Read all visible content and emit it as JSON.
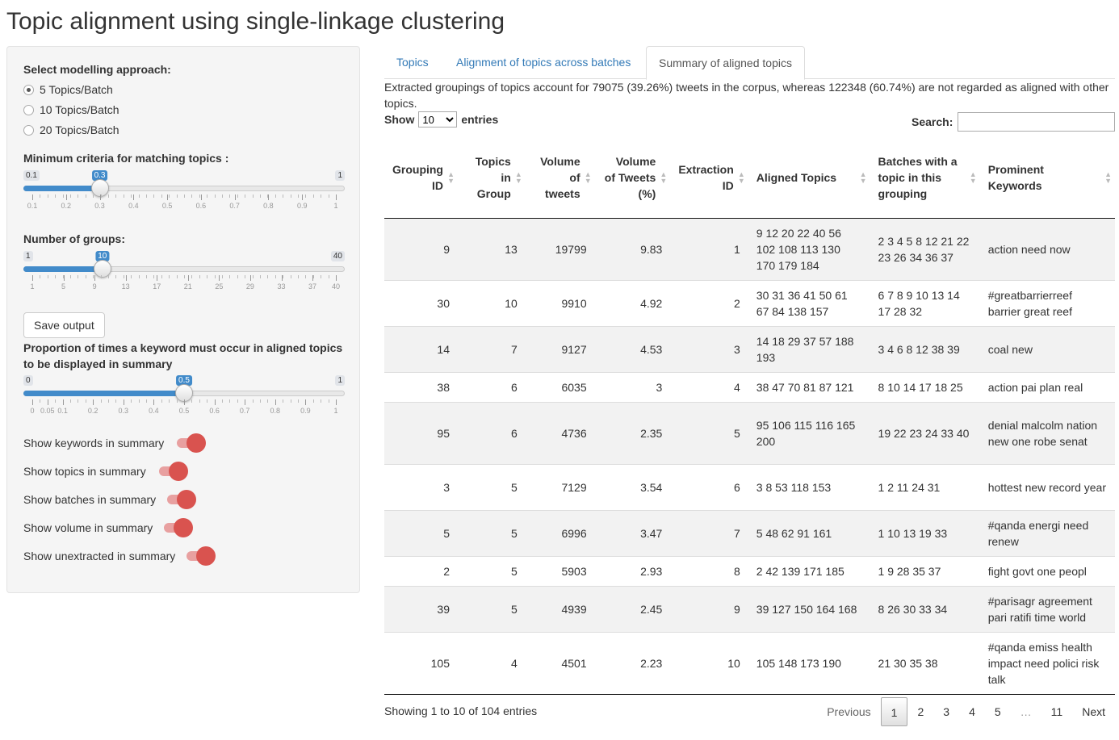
{
  "title": "Topic alignment using single-linkage clustering",
  "sidebar": {
    "modelling_label": "Select modelling approach:",
    "options": [
      "5 Topics/Batch",
      "10 Topics/Batch",
      "20 Topics/Batch"
    ],
    "selected_option": "5 Topics/Batch",
    "criteria_label": "Minimum criteria for matching topics :",
    "criteria_slider": {
      "min": "0.1",
      "max": "1",
      "value": "0.3",
      "ticks": [
        "0.1",
        "0.2",
        "0.3",
        "0.4",
        "0.5",
        "0.6",
        "0.7",
        "0.8",
        "0.9",
        "1"
      ]
    },
    "groups_label": "Number of groups:",
    "groups_slider": {
      "min": "1",
      "max": "40",
      "value": "10",
      "ticks": [
        "1",
        "5",
        "9",
        "13",
        "17",
        "21",
        "25",
        "29",
        "33",
        "37",
        "40"
      ]
    },
    "save_label": "Save output",
    "proportion_label": "Proportion of times a keyword must occur in aligned topics to be displayed in summary",
    "proportion_slider": {
      "min": "0",
      "max": "1",
      "value": "0.5",
      "ticks": [
        "0",
        "0.05",
        "0.1",
        "0.2",
        "0.3",
        "0.4",
        "0.5",
        "0.6",
        "0.7",
        "0.8",
        "0.9",
        "1"
      ]
    },
    "toggles": [
      {
        "label": "Show keywords in summary",
        "on": true
      },
      {
        "label": "Show topics in summary",
        "on": true
      },
      {
        "label": "Show batches in summary",
        "on": true
      },
      {
        "label": "Show volume in summary",
        "on": true
      },
      {
        "label": "Show unextracted in summary",
        "on": true
      }
    ],
    "accent": "#428bca",
    "toggle_color": "#d9534f"
  },
  "tabs": [
    "Topics",
    "Alignment of topics across batches",
    "Summary of aligned topics"
  ],
  "active_tab": "Summary of aligned topics",
  "summary_text": "Extracted groupings of topics account for 79075 (39.26%) tweets in the corpus, whereas 122348 (60.74%) are not regarded as aligned with other topics.",
  "show": {
    "prefix": "Show",
    "value": "10",
    "suffix": "entries"
  },
  "search_label": "Search:",
  "table": {
    "headers": [
      "Grouping ID",
      "Topics in Group",
      "Volume of tweets",
      "Volume of Tweets (%)",
      "Extraction ID",
      "Aligned Topics",
      "Batches with a topic in this grouping",
      "Prominent Keywords"
    ],
    "rows": [
      [
        "9",
        "13",
        "19799",
        "9.83",
        "1",
        "9 12 20 22 40 56 102 108 113 130 170 179 184",
        "2 3 4 5 8 12 21 22 23 26 34 36 37",
        "action need now"
      ],
      [
        "30",
        "10",
        "9910",
        "4.92",
        "2",
        "30 31 36 41 50 61 67 84 138 157",
        "6 7 8 9 10 13 14 17 28 32",
        "#greatbarrierreef barrier great reef"
      ],
      [
        "14",
        "7",
        "9127",
        "4.53",
        "3",
        "14 18 29 37 57 188 193",
        "3 4 6 8 12 38 39",
        "coal new"
      ],
      [
        "38",
        "6",
        "6035",
        "3",
        "4",
        "38 47 70 81 87 121",
        "8 10 14 17 18 25",
        "action pai plan real"
      ],
      [
        "95",
        "6",
        "4736",
        "2.35",
        "5",
        "95 106 115 116 165 200",
        "19 22 23 24 33 40",
        "denial malcolm nation new one robe senat"
      ],
      [
        "3",
        "5",
        "7129",
        "3.54",
        "6",
        "3 8 53 118 153",
        "1 2 11 24 31",
        "hottest new record year"
      ],
      [
        "5",
        "5",
        "6996",
        "3.47",
        "7",
        "5 48 62 91 161",
        "1 10 13 19 33",
        "#qanda energi need renew"
      ],
      [
        "2",
        "5",
        "5903",
        "2.93",
        "8",
        "2 42 139 171 185",
        "1 9 28 35 37",
        "fight govt one peopl"
      ],
      [
        "39",
        "5",
        "4939",
        "2.45",
        "9",
        "39 127 150 164 168",
        "8 26 30 33 34",
        "#parisagr agreement pari ratifi time world"
      ],
      [
        "105",
        "4",
        "4501",
        "2.23",
        "10",
        "105 148 173 190",
        "21 30 35 38",
        "#qanda emiss health impact need polici risk talk"
      ]
    ]
  },
  "info": "Showing 1 to 10 of 104 entries",
  "pagination": [
    "Previous",
    "1",
    "2",
    "3",
    "4",
    "5",
    "…",
    "11",
    "Next"
  ],
  "current_page": "1"
}
